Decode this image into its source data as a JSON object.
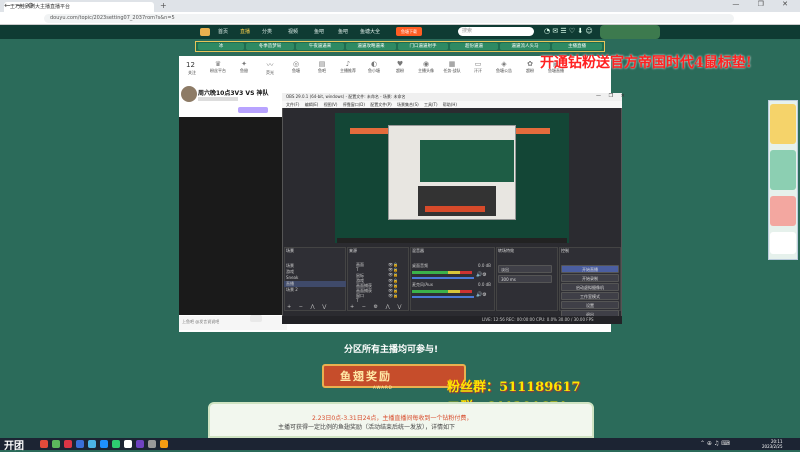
{
  "browser": {
    "tab_title": "王巧娃刷刷大主播直播平台",
    "url": "douyu.com/topic/2023setting07_2037rom?s&n=5",
    "controls": "— ❐ ✕"
  },
  "site": {
    "nav": [
      "首页",
      "直播",
      "分类",
      "视频",
      "鱼吧",
      "鱼吧",
      "鱼塘大全"
    ],
    "search_placeholder": "搜索",
    "download_label": "鱼塘下载"
  },
  "categories": [
    "冰",
    "冬季造梦局",
    "午夜逼逼来",
    "逼逼攻略逼来",
    "门口逼逼射手",
    "超份逼逼",
    "逼逼流人头马",
    "主播直播"
  ],
  "promo_text": "开通钻粉送官方帝国时代4鼠标垫!",
  "room": {
    "title": "周六晚10点3V3 VS 神队",
    "icons": [
      {
        "label": "关注"
      },
      {
        "label": "粉丝平台"
      },
      {
        "label": "鱼翅"
      },
      {
        "label": "荧光"
      },
      {
        "label": "鱼塘"
      },
      {
        "label": "鱼吧"
      },
      {
        "label": "主播推荐"
      },
      {
        "label": "鱼小塘"
      },
      {
        "label": "超粉"
      },
      {
        "label": "主播头像"
      },
      {
        "label": "任务·战队"
      },
      {
        "label": "汗汗"
      },
      {
        "label": "鱼塘公告"
      },
      {
        "label": "超粉"
      },
      {
        "label": "鱼塘直播"
      }
    ],
    "followers_count": "12",
    "chat_hint": "上鱼吧 @发言说说吧"
  },
  "obs": {
    "title": "OBS 29.0.1 (64-bit, windows) - 配置文件: 未命名 - 场景: 未命名",
    "menu": "文件(F) 编辑(E) 视图(V) 停靠窗口(D) 配置文件(P) 场景集合(S) 工具(T) 帮助(H)",
    "scenes_header": "场景",
    "scenes": [
      "场景",
      "游戏",
      "Sneak",
      "直播",
      "场景 2"
    ],
    "sources_header": "来源",
    "sources": [
      "画面",
      "T",
      "鼠标",
      "游戏",
      "画面捕获",
      "画面捕获",
      "窗口",
      "T",
      "画面"
    ],
    "mixer_header": "混音器",
    "mixer": [
      {
        "name": "桌面音频",
        "db": "0.0 dB"
      },
      {
        "name": "麦克风/Aux",
        "db": "0.0 dB"
      }
    ],
    "transitions_header": "转场特效",
    "transition": "淡出",
    "duration": "300 ms",
    "controls_header": "控制",
    "controls": [
      "开始直播",
      "开始录制",
      "启动虚拟摄像机",
      "工作室模式",
      "设置",
      "退出"
    ],
    "status": "LIVE: 12:56   REC: 00:00:00   CPU: 0.0%   30.00 / 30.00 FPS"
  },
  "bottom": {
    "everyone": "分区所有主播均可参与!",
    "reward_title": "鱼翅奖励",
    "award": "AWARD",
    "fans1": "粉丝群：511189617",
    "fans2": "二群：641201671",
    "rules1": "2.23日0点-3.31日24点，主播直播间每收到一个钻粉付费，",
    "rules2": "主播可获得一定比例的鱼翅奖励（活动结束后统一发放），详情如下"
  },
  "taskbar": {
    "start": "开团",
    "time": "20:11",
    "date": "2023/2/25"
  },
  "colors": {
    "page_bg": "#2b6b5a",
    "promo": "#ff2020",
    "fans": "#ffe600",
    "ribbon": "#c64d2b"
  }
}
